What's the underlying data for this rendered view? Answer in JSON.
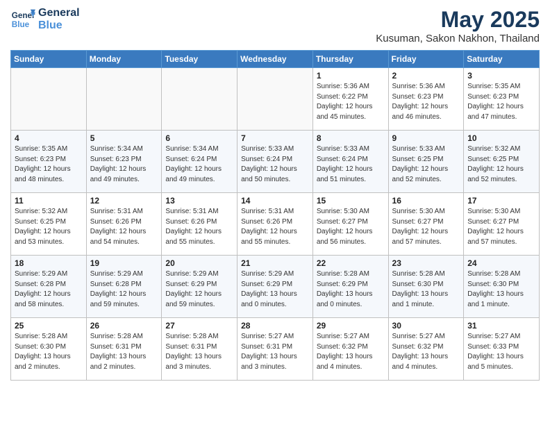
{
  "header": {
    "logo_line1": "General",
    "logo_line2": "Blue",
    "month": "May 2025",
    "location": "Kusuman, Sakon Nakhon, Thailand"
  },
  "weekdays": [
    "Sunday",
    "Monday",
    "Tuesday",
    "Wednesday",
    "Thursday",
    "Friday",
    "Saturday"
  ],
  "weeks": [
    [
      {
        "day": "",
        "info": ""
      },
      {
        "day": "",
        "info": ""
      },
      {
        "day": "",
        "info": ""
      },
      {
        "day": "",
        "info": ""
      },
      {
        "day": "1",
        "info": "Sunrise: 5:36 AM\nSunset: 6:22 PM\nDaylight: 12 hours\nand 45 minutes."
      },
      {
        "day": "2",
        "info": "Sunrise: 5:36 AM\nSunset: 6:23 PM\nDaylight: 12 hours\nand 46 minutes."
      },
      {
        "day": "3",
        "info": "Sunrise: 5:35 AM\nSunset: 6:23 PM\nDaylight: 12 hours\nand 47 minutes."
      }
    ],
    [
      {
        "day": "4",
        "info": "Sunrise: 5:35 AM\nSunset: 6:23 PM\nDaylight: 12 hours\nand 48 minutes."
      },
      {
        "day": "5",
        "info": "Sunrise: 5:34 AM\nSunset: 6:23 PM\nDaylight: 12 hours\nand 49 minutes."
      },
      {
        "day": "6",
        "info": "Sunrise: 5:34 AM\nSunset: 6:24 PM\nDaylight: 12 hours\nand 49 minutes."
      },
      {
        "day": "7",
        "info": "Sunrise: 5:33 AM\nSunset: 6:24 PM\nDaylight: 12 hours\nand 50 minutes."
      },
      {
        "day": "8",
        "info": "Sunrise: 5:33 AM\nSunset: 6:24 PM\nDaylight: 12 hours\nand 51 minutes."
      },
      {
        "day": "9",
        "info": "Sunrise: 5:33 AM\nSunset: 6:25 PM\nDaylight: 12 hours\nand 52 minutes."
      },
      {
        "day": "10",
        "info": "Sunrise: 5:32 AM\nSunset: 6:25 PM\nDaylight: 12 hours\nand 52 minutes."
      }
    ],
    [
      {
        "day": "11",
        "info": "Sunrise: 5:32 AM\nSunset: 6:25 PM\nDaylight: 12 hours\nand 53 minutes."
      },
      {
        "day": "12",
        "info": "Sunrise: 5:31 AM\nSunset: 6:26 PM\nDaylight: 12 hours\nand 54 minutes."
      },
      {
        "day": "13",
        "info": "Sunrise: 5:31 AM\nSunset: 6:26 PM\nDaylight: 12 hours\nand 55 minutes."
      },
      {
        "day": "14",
        "info": "Sunrise: 5:31 AM\nSunset: 6:26 PM\nDaylight: 12 hours\nand 55 minutes."
      },
      {
        "day": "15",
        "info": "Sunrise: 5:30 AM\nSunset: 6:27 PM\nDaylight: 12 hours\nand 56 minutes."
      },
      {
        "day": "16",
        "info": "Sunrise: 5:30 AM\nSunset: 6:27 PM\nDaylight: 12 hours\nand 57 minutes."
      },
      {
        "day": "17",
        "info": "Sunrise: 5:30 AM\nSunset: 6:27 PM\nDaylight: 12 hours\nand 57 minutes."
      }
    ],
    [
      {
        "day": "18",
        "info": "Sunrise: 5:29 AM\nSunset: 6:28 PM\nDaylight: 12 hours\nand 58 minutes."
      },
      {
        "day": "19",
        "info": "Sunrise: 5:29 AM\nSunset: 6:28 PM\nDaylight: 12 hours\nand 59 minutes."
      },
      {
        "day": "20",
        "info": "Sunrise: 5:29 AM\nSunset: 6:29 PM\nDaylight: 12 hours\nand 59 minutes."
      },
      {
        "day": "21",
        "info": "Sunrise: 5:29 AM\nSunset: 6:29 PM\nDaylight: 13 hours\nand 0 minutes."
      },
      {
        "day": "22",
        "info": "Sunrise: 5:28 AM\nSunset: 6:29 PM\nDaylight: 13 hours\nand 0 minutes."
      },
      {
        "day": "23",
        "info": "Sunrise: 5:28 AM\nSunset: 6:30 PM\nDaylight: 13 hours\nand 1 minute."
      },
      {
        "day": "24",
        "info": "Sunrise: 5:28 AM\nSunset: 6:30 PM\nDaylight: 13 hours\nand 1 minute."
      }
    ],
    [
      {
        "day": "25",
        "info": "Sunrise: 5:28 AM\nSunset: 6:30 PM\nDaylight: 13 hours\nand 2 minutes."
      },
      {
        "day": "26",
        "info": "Sunrise: 5:28 AM\nSunset: 6:31 PM\nDaylight: 13 hours\nand 2 minutes."
      },
      {
        "day": "27",
        "info": "Sunrise: 5:28 AM\nSunset: 6:31 PM\nDaylight: 13 hours\nand 3 minutes."
      },
      {
        "day": "28",
        "info": "Sunrise: 5:27 AM\nSunset: 6:31 PM\nDaylight: 13 hours\nand 3 minutes."
      },
      {
        "day": "29",
        "info": "Sunrise: 5:27 AM\nSunset: 6:32 PM\nDaylight: 13 hours\nand 4 minutes."
      },
      {
        "day": "30",
        "info": "Sunrise: 5:27 AM\nSunset: 6:32 PM\nDaylight: 13 hours\nand 4 minutes."
      },
      {
        "day": "31",
        "info": "Sunrise: 5:27 AM\nSunset: 6:33 PM\nDaylight: 13 hours\nand 5 minutes."
      }
    ]
  ]
}
